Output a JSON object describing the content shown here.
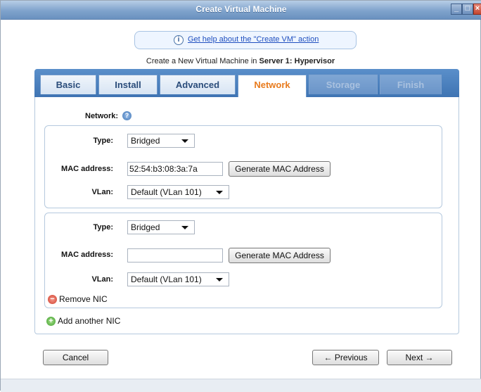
{
  "window": {
    "title": "Create Virtual Machine"
  },
  "help": {
    "link_text": "Get help about the \"Create VM\" action"
  },
  "subtitle": {
    "prefix": "Create a New Virtual Machine in ",
    "server": "Server 1: Hypervisor"
  },
  "tabs": [
    {
      "label": "Basic",
      "state": "normal"
    },
    {
      "label": "Install",
      "state": "normal"
    },
    {
      "label": "Advanced",
      "state": "normal"
    },
    {
      "label": "Network",
      "state": "active"
    },
    {
      "label": "Storage",
      "state": "disabled"
    },
    {
      "label": "Finish",
      "state": "disabled"
    }
  ],
  "network": {
    "label": "Network:",
    "nics": [
      {
        "type_label": "Type:",
        "type_value": "Bridged",
        "mac_label": "MAC address:",
        "mac_value": "52:54:b3:08:3a:7a",
        "generate_label": "Generate MAC Address",
        "vlan_label": "VLan:",
        "vlan_value": "Default (VLan 101)"
      },
      {
        "type_label": "Type:",
        "type_value": "Bridged",
        "mac_label": "MAC address:",
        "mac_value": "",
        "generate_label": "Generate MAC Address",
        "vlan_label": "VLan:",
        "vlan_value": "Default (VLan 101)",
        "remove_label": "Remove NIC"
      }
    ],
    "add_label": "Add another NIC"
  },
  "footer": {
    "cancel": "Cancel",
    "previous": "← Previous",
    "next": "Next →"
  },
  "colors": {
    "title_bar": "#7fa3cc",
    "tab_strip": "#3f74b3",
    "active_tab_text": "#e87b1d",
    "link": "#1f4fbf"
  }
}
